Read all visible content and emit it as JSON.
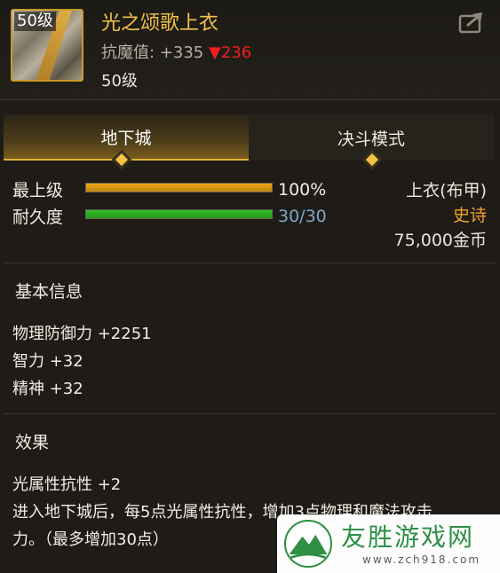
{
  "item": {
    "icon_level": "50级",
    "name": "光之颂歌上衣",
    "stat_label": "抗魔值:",
    "stat_value": "+335",
    "stat_change": "▼236",
    "level": "50级"
  },
  "tabs": [
    {
      "label": "地下城",
      "active": true
    },
    {
      "label": "决斗模式",
      "active": false
    }
  ],
  "bars": [
    {
      "label": "最上级",
      "value_text": "100%",
      "fraction": 1.0,
      "color": "#f0a416"
    },
    {
      "label": "耐久度",
      "value_text": "30/30",
      "fraction": 1.0,
      "color": "#2fbe27"
    }
  ],
  "right_info": {
    "slot": "上衣(布甲)",
    "rarity": "史诗",
    "price": "75,000金币"
  },
  "sections": {
    "basic_title": "基本信息",
    "basic_lines": [
      "物理防御力 +2251",
      "智力 +32",
      "精神 +32"
    ],
    "effect_title": "效果",
    "effect_lines": [
      "光属性抗性 +2",
      "进入地下城后，每5点光属性抗性，增加3点物理和魔法攻击",
      "力。（最多增加30点）"
    ]
  },
  "watermark": {
    "text": "友胜游戏网",
    "url": "www.zch918.com"
  },
  "colors": {
    "gold": "#f3c246",
    "rarity": "#f3a223",
    "down_red": "#ef1f1f",
    "durability_text": "#7fa6c9"
  },
  "icons": [
    "share-icon",
    "diamond-marker-icon",
    "mountain-logo-icon"
  ]
}
